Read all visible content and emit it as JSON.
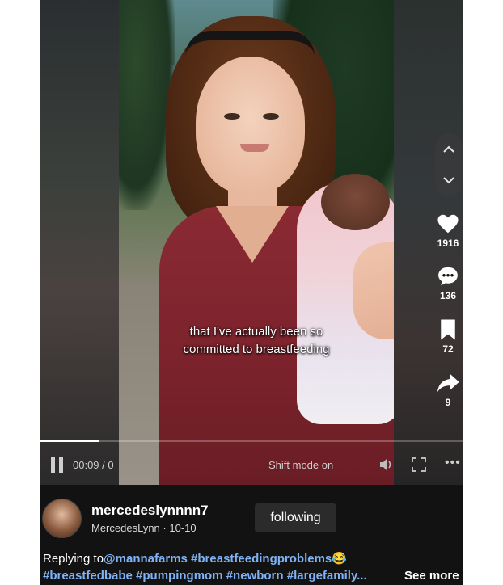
{
  "video": {
    "caption_line1": "that I've actually been so",
    "caption_line2": "committed to breastfeeding"
  },
  "actions": {
    "likes": "1916",
    "comments": "136",
    "saves": "72",
    "shares": "9"
  },
  "player": {
    "time": "00:09 / 0",
    "mode_label": "Shift mode on",
    "progress": 0.14
  },
  "author": {
    "username": "mercedeslynnnn7",
    "nickname": "MercedesLynn",
    "date": "10-10",
    "follow_label": "following"
  },
  "description": {
    "replying_prefix": "Replying to",
    "mention": "@mannafarms",
    "tag1": "#breastfeedingproblems",
    "emoji": "😂",
    "tag2": "#breastfedbabe",
    "tag3": "#pumpingmom",
    "tag4": "#newborn",
    "tag5": "#largefamily...",
    "see_more": "See more"
  },
  "icons": [
    "chevron-up-icon",
    "chevron-down-icon",
    "heart-icon",
    "comment-icon",
    "bookmark-icon",
    "share-icon",
    "pause-icon",
    "volume-icon",
    "fullscreen-icon",
    "more-icon"
  ]
}
